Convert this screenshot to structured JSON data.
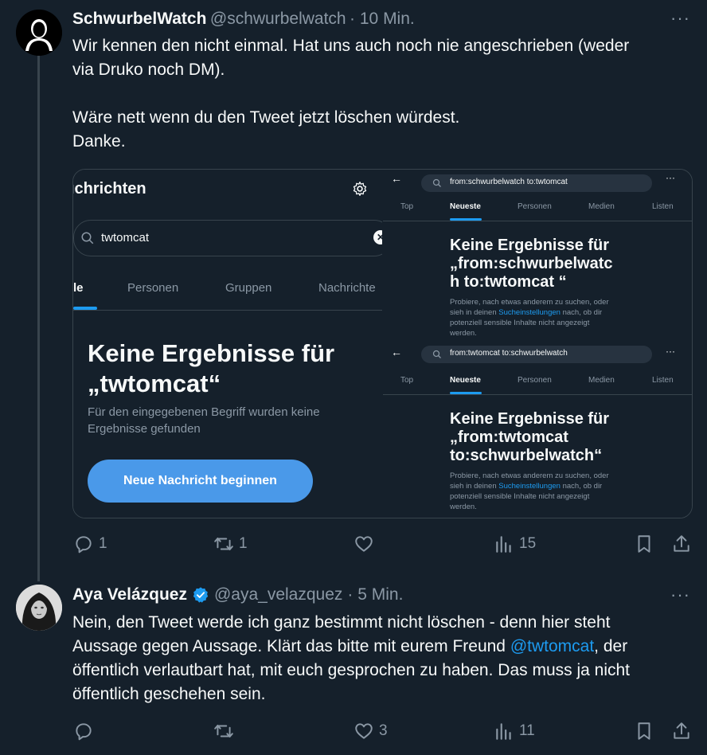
{
  "tweet1": {
    "name": "SchwurbelWatch",
    "handle": "@schwurbelwatch",
    "time": "· 10 Min.",
    "more": "···",
    "lines": [
      "Wir kennen den nicht einmal. Hat uns auch noch nie angeschrieben (weder",
      "via Druko noch DM).",
      "",
      "Wäre nett wenn du den Tweet jetzt löschen würdest.",
      "Danke."
    ],
    "actions": {
      "reply": "1",
      "retweet": "1",
      "like": "",
      "views": "15"
    }
  },
  "media": {
    "left": {
      "title": "ıchrichten",
      "search": "twtomcat",
      "tabs": [
        "le",
        "Personen",
        "Gruppen",
        "Nachrichte"
      ],
      "heading_line1": "Keine Ergebnisse für",
      "heading_line2": "„twtomcat“",
      "sub_line1": "Für den eingegebenen Begriff wurden keine",
      "sub_line2": "Ergebnisse gefunden",
      "button": "Neue Nachricht beginnen"
    },
    "right_top": {
      "query": "from:schwurbelwatch to:twtomcat",
      "tabs": [
        "Top",
        "Neueste",
        "Personen",
        "Medien",
        "Listen"
      ],
      "h1": "Keine Ergebnisse für",
      "h2": "„from:schwurbelwatc",
      "h3": "h to:twtomcat “",
      "p1": "Probiere, nach etwas anderem zu suchen, oder",
      "p2a": "sieh in deinen ",
      "p2link": "Sucheinstellungen",
      "p2b": " nach, ob dir",
      "p3": "potenziell sensible Inhalte nicht angezeigt",
      "p4": "werden."
    },
    "right_bottom": {
      "query": "from:twtomcat to:schwurbelwatch",
      "tabs": [
        "Top",
        "Neueste",
        "Personen",
        "Medien",
        "Listen"
      ],
      "h1": "Keine Ergebnisse für",
      "h2": "„from:twtomcat",
      "h3": "to:schwurbelwatch“",
      "p1": "Probiere, nach etwas anderem zu suchen, oder",
      "p2a": "sieh in deinen ",
      "p2link": "Sucheinstellungen",
      "p2b": " nach, ob dir",
      "p3": "potenziell sensible Inhalte nicht angezeigt",
      "p4": "werden."
    }
  },
  "tweet2": {
    "name": "Aya Velázquez",
    "handle": "@aya_velazquez",
    "time": "· 5 Min.",
    "more": "···",
    "line1": "Nein, den Tweet werde ich ganz bestimmt nicht löschen - denn hier steht",
    "line2a": "Aussage gegen Aussage. Klärt das bitte mit eurem Freund ",
    "mention": "@twtomcat",
    "line2b": ", der",
    "line3": "öffentlich verlautbart hat, mit euch gesprochen zu haben. Das muss ja nicht",
    "line4": "öffentlich geschehen sein.",
    "actions": {
      "reply": "",
      "retweet": "",
      "like": "3",
      "views": "11"
    }
  },
  "colors": {
    "background": "#15202b",
    "accent": "#1d9bf0",
    "muted": "#8b98a5",
    "verified": "#1d9bf0"
  }
}
